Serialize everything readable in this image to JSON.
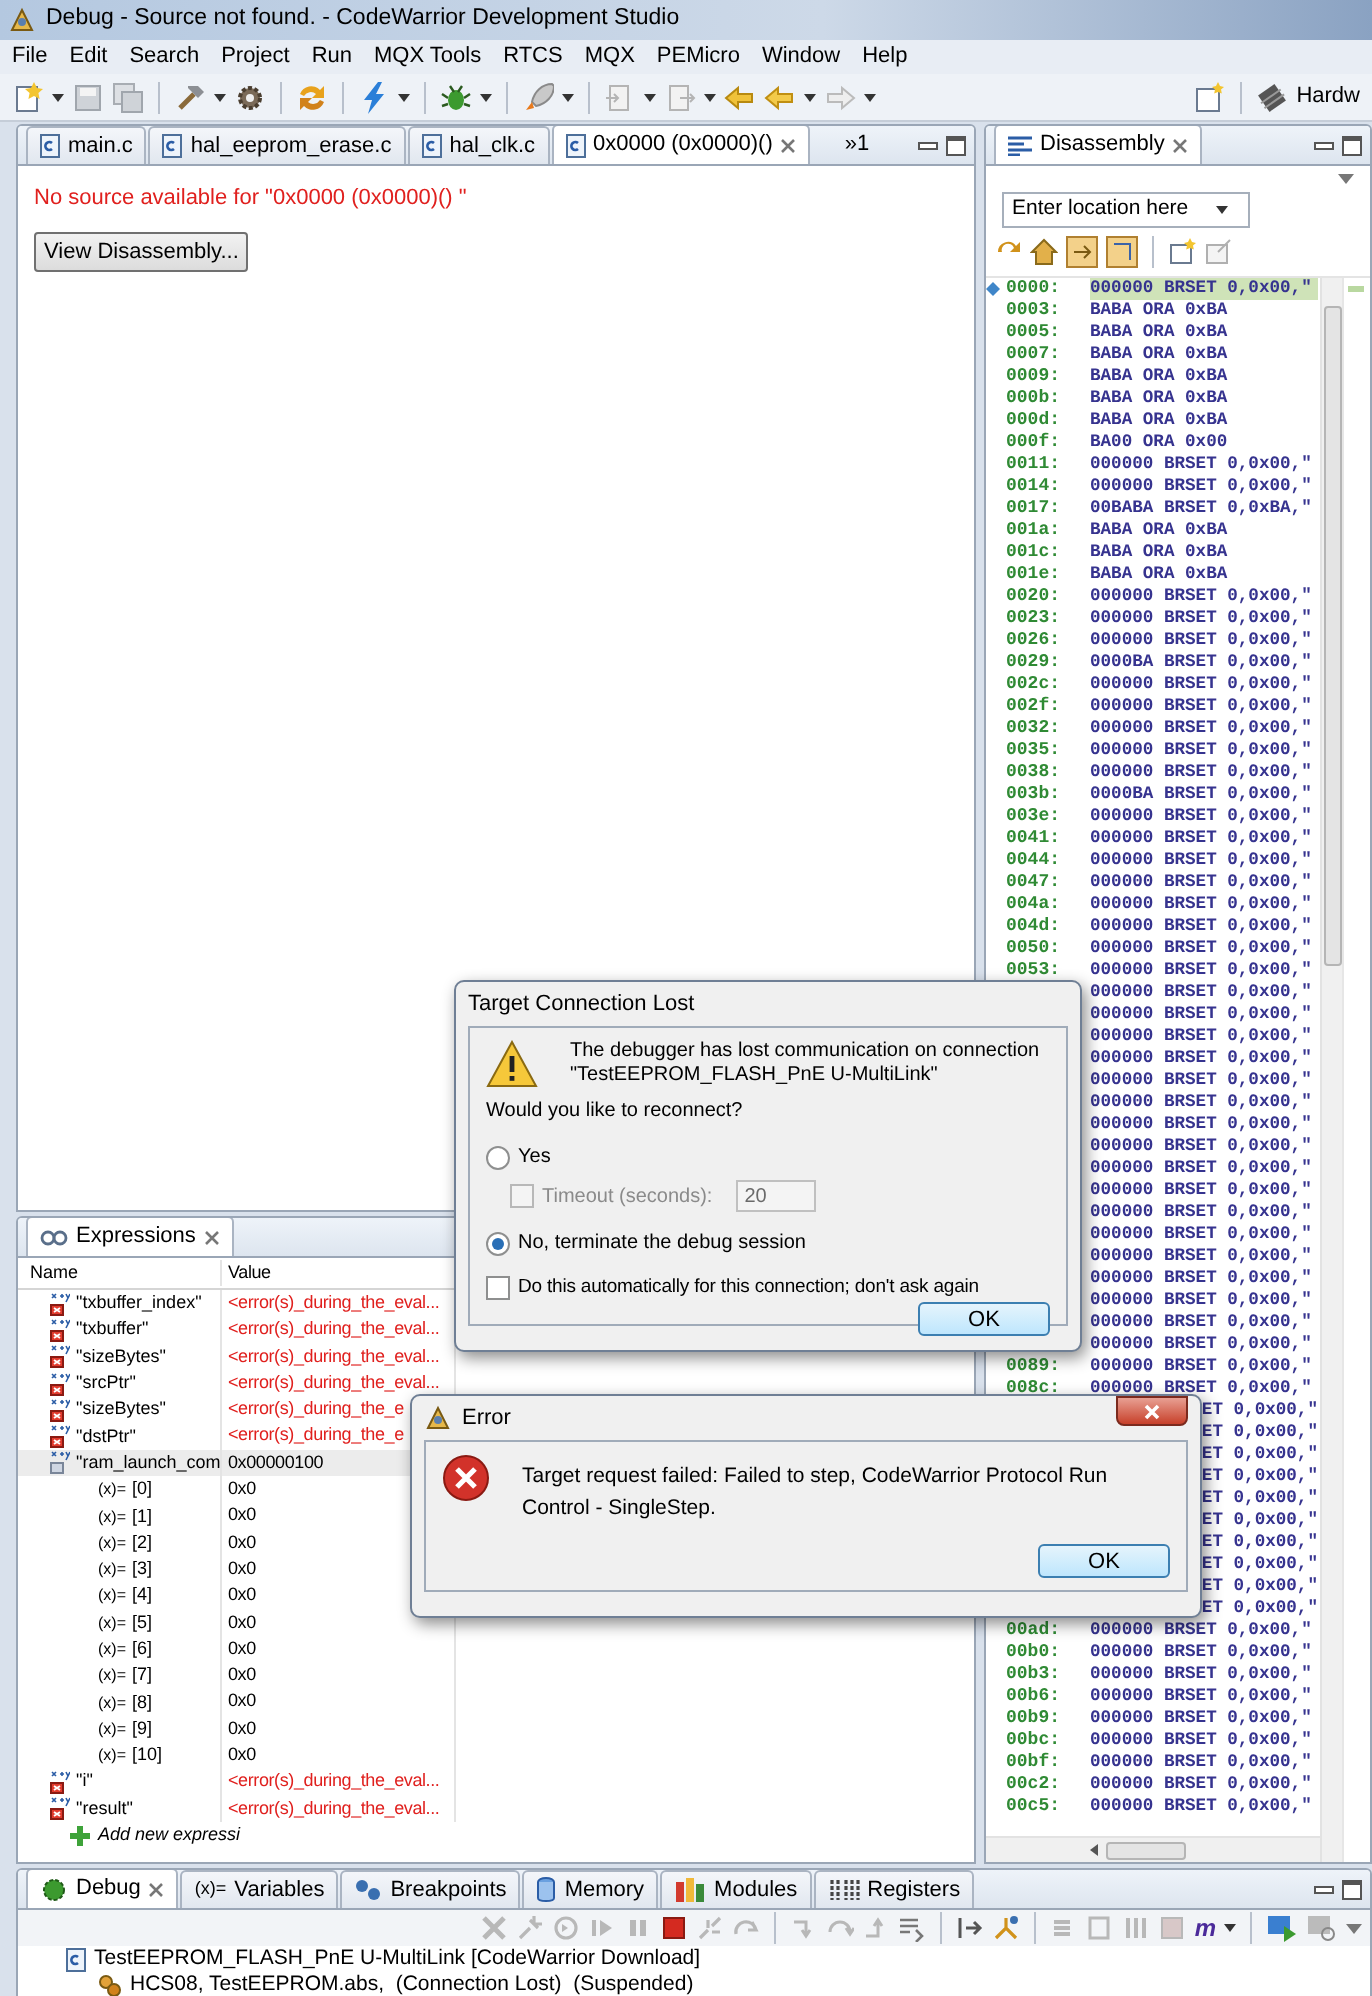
{
  "window": {
    "title": "Debug - Source not found. - CodeWarrior Development Studio"
  },
  "menu": [
    "File",
    "Edit",
    "Search",
    "Project",
    "Run",
    "MQX Tools",
    "RTCS",
    "MQX",
    "PEMicro",
    "Window",
    "Help"
  ],
  "toolbar": {
    "perspective": "Hardw"
  },
  "editor": {
    "tabs": [
      {
        "label": "main.c",
        "selected": false
      },
      {
        "label": "hal_eeprom_erase.c",
        "selected": false
      },
      {
        "label": "hal_clk.c",
        "selected": false
      },
      {
        "label": "0x0000 (0x0000)()",
        "selected": true
      }
    ],
    "overflow": "»1",
    "message": "No source available for \"0x0000 (0x0000)() \"",
    "button": "View Disassembly..."
  },
  "disassembly": {
    "tab": "Disassembly",
    "location_placeholder": "Enter location here",
    "rows": [
      {
        "address": "0000:",
        "instruction": "000000 BRSET 0,0x00,\"",
        "current": true,
        "kind": "full"
      },
      {
        "address": "0003:",
        "instruction": "BABA ORA 0xBA",
        "current": false,
        "kind": "full"
      },
      {
        "address": "0005:",
        "instruction": "BABA ORA 0xBA",
        "current": false,
        "kind": "full"
      },
      {
        "address": "0007:",
        "instruction": "BABA ORA 0xBA",
        "current": false,
        "kind": "full"
      },
      {
        "address": "0009:",
        "instruction": "BABA ORA 0xBA",
        "current": false,
        "kind": "full"
      },
      {
        "address": "000b:",
        "instruction": "BABA ORA 0xBA",
        "current": false,
        "kind": "full"
      },
      {
        "address": "000d:",
        "instruction": "BABA ORA 0xBA",
        "current": false,
        "kind": "full"
      },
      {
        "address": "000f:",
        "instruction": "BA00 ORA 0x00",
        "current": false,
        "kind": "full"
      },
      {
        "address": "0011:",
        "instruction": "000000 BRSET 0,0x00,\"",
        "current": false,
        "kind": "full"
      },
      {
        "address": "0014:",
        "instruction": "000000 BRSET 0,0x00,\"",
        "current": false,
        "kind": "full"
      },
      {
        "address": "0017:",
        "instruction": "00BABA BRSET 0,0xBA,\"",
        "current": false,
        "kind": "full"
      },
      {
        "address": "001a:",
        "instruction": "BABA ORA 0xBA",
        "current": false,
        "kind": "full"
      },
      {
        "address": "001c:",
        "instruction": "BABA ORA 0xBA",
        "current": false,
        "kind": "full"
      },
      {
        "address": "001e:",
        "instruction": "BABA ORA 0xBA",
        "current": false,
        "kind": "full"
      },
      {
        "address": "0020:",
        "instruction": "000000 BRSET 0,0x00,\"",
        "current": false,
        "kind": "full"
      },
      {
        "address": "0023:",
        "instruction": "000000 BRSET 0,0x00,\"",
        "current": false,
        "kind": "full"
      },
      {
        "address": "0026:",
        "instruction": "000000 BRSET 0,0x00,\"",
        "current": false,
        "kind": "full"
      },
      {
        "address": "0029:",
        "instruction": "0000BA BRSET 0,0x00,\"",
        "current": false,
        "kind": "full"
      },
      {
        "address": "002c:",
        "instruction": "000000 BRSET 0,0x00,\"",
        "current": false,
        "kind": "full"
      },
      {
        "address": "002f:",
        "instruction": "000000 BRSET 0,0x00,\"",
        "current": false,
        "kind": "full"
      },
      {
        "address": "0032:",
        "instruction": "000000 BRSET 0,0x00,\"",
        "current": false,
        "kind": "full"
      },
      {
        "address": "0035:",
        "instruction": "000000 BRSET 0,0x00,\"",
        "current": false,
        "kind": "full"
      },
      {
        "address": "0038:",
        "instruction": "000000 BRSET 0,0x00,\"",
        "current": false,
        "kind": "full"
      },
      {
        "address": "003b:",
        "instruction": "0000BA BRSET 0,0x00,\"",
        "current": false,
        "kind": "full"
      },
      {
        "address": "003e:",
        "instruction": "000000 BRSET 0,0x00,\"",
        "current": false,
        "kind": "full"
      },
      {
        "address": "0041:",
        "instruction": "000000 BRSET 0,0x00,\"",
        "current": false,
        "kind": "full"
      },
      {
        "address": "0044:",
        "instruction": "000000 BRSET 0,0x00,\"",
        "current": false,
        "kind": "full"
      },
      {
        "address": "0047:",
        "instruction": "000000 BRSET 0,0x00,\"",
        "current": false,
        "kind": "full"
      },
      {
        "address": "004a:",
        "instruction": "000000 BRSET 0,0x00,\"",
        "current": false,
        "kind": "full"
      },
      {
        "address": "004d:",
        "instruction": "000000 BRSET 0,0x00,\"",
        "current": false,
        "kind": "full"
      },
      {
        "address": "0050:",
        "instruction": "000000 BRSET 0,0x00,\"",
        "current": false,
        "kind": "full"
      },
      {
        "address": "0053:",
        "instruction": "000000 BRSET 0,0x00,\"",
        "current": false,
        "kind": "full"
      },
      {
        "instruction": "000000 BRSET 0,0x00,\"",
        "current": false,
        "kind": "full"
      },
      {
        "instruction": "000000 BRSET 0,0x00,\"",
        "current": false,
        "kind": "full"
      },
      {
        "instruction": "000000 BRSET 0,0x00,\"",
        "current": false,
        "kind": "full"
      },
      {
        "instruction": "000000 BRSET 0,0x00,\"",
        "current": false,
        "kind": "full"
      },
      {
        "instruction": "000000 BRSET 0,0x00,\"",
        "current": false,
        "kind": "full"
      },
      {
        "instruction": "000000 BRSET 0,0x00,\"",
        "current": false,
        "kind": "full"
      },
      {
        "instruction": "000000 BRSET 0,0x00,\"",
        "current": false,
        "kind": "full"
      },
      {
        "instruction": "000000 BRSET 0,0x00,\"",
        "current": false,
        "kind": "full"
      },
      {
        "instruction": "000000 BRSET 0,0x00,\"",
        "current": false,
        "kind": "full"
      },
      {
        "instruction": "000000 BRSET 0,0x00,\"",
        "current": false,
        "kind": "full"
      },
      {
        "instruction": "000000 BRSET 0,0x00,\"",
        "current": false,
        "kind": "full"
      },
      {
        "instruction": "000000 BRSET 0,0x00,\"",
        "current": false,
        "kind": "full"
      },
      {
        "instruction": "000000 BRSET 0,0x00,\"",
        "current": false,
        "kind": "full"
      },
      {
        "instruction": "000000 BRSET 0,0x00,\"",
        "current": false,
        "kind": "full"
      },
      {
        "instruction": "000000 BRSET 0,0x00,\"",
        "current": false,
        "kind": "full"
      },
      {
        "instruction": "000000 BRSET 0,0x00,\"",
        "current": false,
        "kind": "full"
      },
      {
        "instruction": "000000 BRSET 0,0x00,\"",
        "current": false,
        "kind": "full"
      },
      {
        "address": "0089:",
        "instruction": "000000 BRSET 0,0x00,\"",
        "current": false,
        "kind": "full"
      },
      {
        "address": "008c:",
        "instruction": "000000 BRSET 0,0x00,\"",
        "current": false,
        "kind": "full"
      },
      {
        "instruction": "ET 0,0x00,\"",
        "current": false,
        "kind": "partial"
      },
      {
        "instruction": "ET 0,0x00,\"",
        "current": false,
        "kind": "partial"
      },
      {
        "instruction": "ET 0,0x00,\"",
        "current": false,
        "kind": "partial"
      },
      {
        "instruction": "ET 0,0x00,\"",
        "current": false,
        "kind": "partial"
      },
      {
        "instruction": "ET 0,0x00,\"",
        "current": false,
        "kind": "partial"
      },
      {
        "instruction": "ET 0,0x00,\"",
        "current": false,
        "kind": "partial"
      },
      {
        "instruction": "ET 0,0x00,\"",
        "current": false,
        "kind": "partial"
      },
      {
        "instruction": "ET 0,0x00,\"",
        "current": false,
        "kind": "partial"
      },
      {
        "instruction": "ET 0,0x00,\"",
        "current": false,
        "kind": "partial"
      },
      {
        "instruction": "ET 0,0x00,\"",
        "current": false,
        "kind": "partial"
      },
      {
        "address": "00ad:",
        "instruction": "000000 BRSET 0,0x00,\"",
        "current": false,
        "kind": "full"
      },
      {
        "address": "00b0:",
        "instruction": "000000 BRSET 0,0x00,\"",
        "current": false,
        "kind": "full"
      },
      {
        "address": "00b3:",
        "instruction": "000000 BRSET 0,0x00,\"",
        "current": false,
        "kind": "full"
      },
      {
        "address": "00b6:",
        "instruction": "000000 BRSET 0,0x00,\"",
        "current": false,
        "kind": "full"
      },
      {
        "address": "00b9:",
        "instruction": "000000 BRSET 0,0x00,\"",
        "current": false,
        "kind": "full"
      },
      {
        "address": "00bc:",
        "instruction": "000000 BRSET 0,0x00,\"",
        "current": false,
        "kind": "full"
      },
      {
        "address": "00bf:",
        "instruction": "000000 BRSET 0,0x00,\"",
        "current": false,
        "kind": "full"
      },
      {
        "address": "00c2:",
        "instruction": "000000 BRSET 0,0x00,\"",
        "current": false,
        "kind": "full"
      },
      {
        "address": "00c5:",
        "instruction": "000000 BRSET 0,0x00,\"",
        "current": false,
        "kind": "full"
      }
    ]
  },
  "expressions": {
    "tab": "Expressions",
    "columns": [
      "Name",
      "Value"
    ],
    "rows": [
      {
        "kind": "error",
        "name": "\"txbuffer_index\"",
        "value": "<error(s)_during_the_eval...",
        "selected": false
      },
      {
        "kind": "error",
        "name": "\"txbuffer\"",
        "value": "<error(s)_during_the_eval...",
        "selected": false
      },
      {
        "kind": "error",
        "name": "\"sizeBytes\"",
        "value": "<error(s)_during_the_eval...",
        "selected": false
      },
      {
        "kind": "error",
        "name": "\"srcPtr\"",
        "value": "<error(s)_during_the_eval...",
        "selected": false
      },
      {
        "kind": "error",
        "name": "\"sizeBytes\"",
        "value": "<error(s)_during_the_e",
        "selected": false
      },
      {
        "kind": "error",
        "name": "\"dstPtr\"",
        "value": "<error(s)_during_the_e",
        "selected": false
      },
      {
        "kind": "ok",
        "name": "\"ram_launch_com",
        "value": "0x00000100",
        "selected": true,
        "children": [
          {
            "marker": "(x)=",
            "name": "[0]",
            "value": "0x0",
            "selected": false
          },
          {
            "marker": "(x)=",
            "name": "[1]",
            "value": "0x0",
            "selected": false
          },
          {
            "marker": "(x)=",
            "name": "[2]",
            "value": "0x0",
            "selected": false
          },
          {
            "marker": "(x)=",
            "name": "[3]",
            "value": "0x0",
            "selected": false
          },
          {
            "marker": "(x)=",
            "name": "[4]",
            "value": "0x0",
            "selected": false
          },
          {
            "marker": "(x)=",
            "name": "[5]",
            "value": "0x0",
            "selected": false
          },
          {
            "marker": "(x)=",
            "name": "[6]",
            "value": "0x0",
            "selected": false
          },
          {
            "marker": "(x)=",
            "name": "[7]",
            "value": "0x0",
            "selected": false
          },
          {
            "marker": "(x)=",
            "name": "[8]",
            "value": "0x0",
            "selected": false
          },
          {
            "marker": "(x)=",
            "name": "[9]",
            "value": "0x0",
            "selected": false
          },
          {
            "marker": "(x)=",
            "name": "[10]",
            "value": "0x0",
            "selected": false
          }
        ]
      },
      {
        "kind": "error",
        "name": "\"i\"",
        "value": "<error(s)_during_the_eval...",
        "selected": false
      },
      {
        "kind": "error",
        "name": "\"result\"",
        "value": "<error(s)_during_the_eval...",
        "selected": false
      }
    ],
    "add": "Add new expressi"
  },
  "debug": {
    "tabs": [
      {
        "label": "Debug",
        "selected": true
      },
      {
        "label": "Variables",
        "selected": false,
        "glyph": "(x)="
      },
      {
        "label": "Breakpoints",
        "selected": false
      },
      {
        "label": "Memory",
        "selected": false
      },
      {
        "label": "Modules",
        "selected": false
      },
      {
        "label": "Registers",
        "selected": false
      }
    ],
    "mode_glyph": "m",
    "tree": [
      {
        "label": "TestEEPROM_FLASH_PnE U-MultiLink [CodeWarrior Download]",
        "children": [
          {
            "label": "HCS08, TestEEPROM.abs,  (Connection Lost)  (Suspended)"
          }
        ]
      }
    ]
  },
  "connection_dialog": {
    "title": "Target Connection Lost",
    "message": "The debugger has lost communication on connection\n\"TestEEPROM_FLASH_PnE U-MultiLink\"",
    "question": "Would you like to reconnect?",
    "options": [
      {
        "label": "Yes",
        "selected": false
      },
      {
        "label": "No, terminate the debug session",
        "selected": true
      }
    ],
    "timeout": {
      "label": "Timeout (seconds):",
      "checked": false,
      "disabled": true,
      "value": "20"
    },
    "remember": {
      "label": "Do this automatically for this connection; don't ask again",
      "checked": false
    },
    "button": "OK"
  },
  "error_dialog": {
    "title": "Error",
    "message": "Target request failed: Failed to step, CodeWarrior Protocol Run Control - SingleStep.",
    "button": "OK"
  }
}
